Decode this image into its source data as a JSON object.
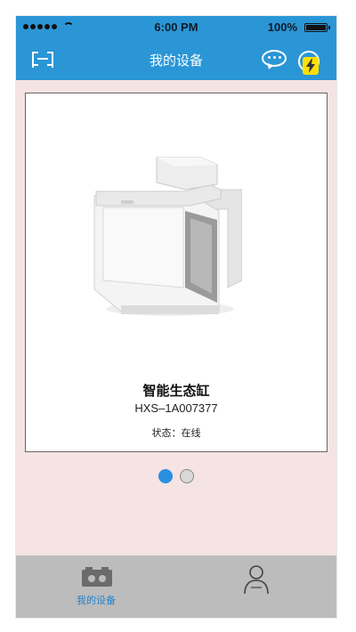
{
  "status_bar": {
    "time": "6:00 PM",
    "battery": "100%"
  },
  "header": {
    "title": "我的设备",
    "menu_icon": "menu-bracket-icon",
    "chat_icon": "chat-bubble-icon",
    "add_icon": "add-circle-icon",
    "badge_icon": "lightning-bolt-icon"
  },
  "device": {
    "name": "智能生态缸",
    "id": "HXS–1A007377",
    "status": "状态：在线",
    "image": "smart-aquarium-tank-image"
  },
  "pagination": {
    "pages": 2,
    "active_index": 0
  },
  "tab_bar": {
    "tabs": [
      {
        "label": "我的设备",
        "icon": "device-box-icon",
        "active": true
      },
      {
        "label": "",
        "icon": "user-profile-icon",
        "active": false
      }
    ]
  },
  "colors": {
    "primary": "#2a96d6",
    "background": "#f6e3e3",
    "tab_bar": "#bcbcbc",
    "active_dot": "#2a8fe0",
    "badge": "#ffe100"
  }
}
